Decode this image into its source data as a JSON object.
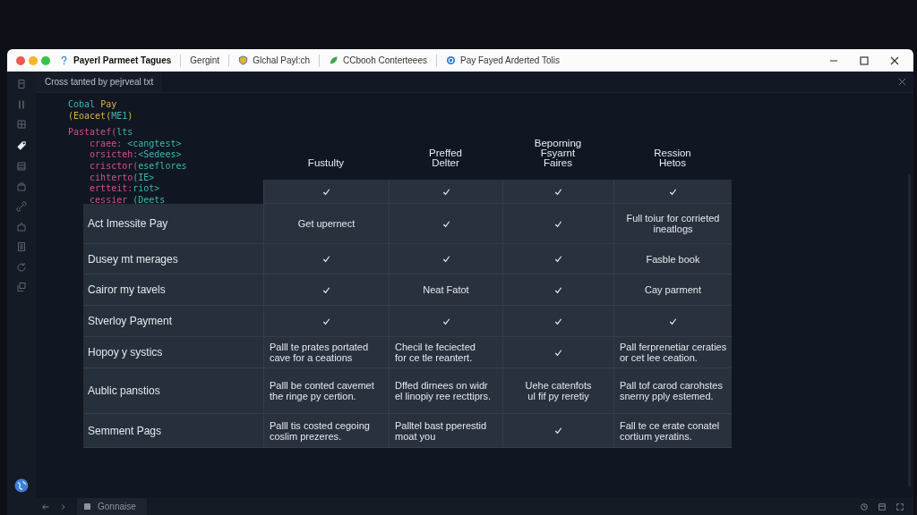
{
  "titlebar": {
    "tabs": [
      {
        "label": "Payerl Parmeet Tagues",
        "kind": "help",
        "selected": true
      },
      {
        "label": "Gergint",
        "kind": "plain",
        "selected": false
      },
      {
        "label": "Glchal Payl:ch",
        "kind": "shield",
        "selected": false
      },
      {
        "label": "CCbooh Conterteees",
        "kind": "leaf",
        "selected": false
      },
      {
        "label": "Pay Fayed Arderted Tolis",
        "kind": "globe",
        "selected": false
      }
    ]
  },
  "sidebar": {
    "items": [
      {
        "kind": "file",
        "selected": false
      },
      {
        "kind": "bars",
        "selected": false
      },
      {
        "kind": "grid",
        "selected": false
      },
      {
        "kind": "tag",
        "selected": true
      },
      {
        "kind": "list",
        "selected": false
      },
      {
        "kind": "box",
        "selected": false
      },
      {
        "kind": "link",
        "selected": false
      },
      {
        "kind": "puzzle",
        "selected": false
      },
      {
        "kind": "doc",
        "selected": false
      },
      {
        "kind": "refresh",
        "selected": false
      },
      {
        "kind": "copy",
        "selected": false
      }
    ]
  },
  "editor_tab": {
    "label": "Cross tanted by pejrveal txt"
  },
  "code": [
    [
      {
        "text": "Cobal ",
        "kind": "value"
      },
      {
        "text": "Pay",
        "kind": "string"
      }
    ],
    [
      {
        "text": "(Eoacet(",
        "kind": "string"
      },
      {
        "text": "ME1",
        "kind": "value"
      },
      {
        "text": ")",
        "kind": "string"
      }
    ],
    [
      {
        "text": "Pastatef(",
        "kind": "keyword"
      },
      {
        "text": "lts",
        "kind": "value"
      }
    ],
    [
      {
        "text": "    craee: ",
        "kind": "keyword"
      },
      {
        "text": "<cangtest>",
        "kind": "value"
      }
    ],
    [
      {
        "text": "    orsicteh:",
        "kind": "keyword"
      },
      {
        "text": "<Sedees>",
        "kind": "value"
      }
    ],
    [
      {
        "text": "    crisctor(",
        "kind": "keyword"
      },
      {
        "text": "eseflores",
        "kind": "value"
      }
    ],
    [
      {
        "text": "    cihterto",
        "kind": "keyword"
      },
      {
        "text": "(IE>",
        "kind": "value"
      }
    ],
    [
      {
        "text": "    ertteit:",
        "kind": "keyword"
      },
      {
        "text": "riot>",
        "kind": "value"
      }
    ],
    [
      {
        "text": "    cessier ",
        "kind": "keyword"
      },
      {
        "text": "(Deets",
        "kind": "value"
      }
    ]
  ],
  "table": {
    "columns": [
      "Fustulty",
      "Preffed\nDelter",
      "Beporning\nFsyarnt\nFaires",
      "Ression\nHetos"
    ],
    "rows": [
      {
        "cells": [
          {
            "kind": "check"
          },
          {
            "kind": "check"
          },
          {
            "kind": "check"
          },
          {
            "kind": "check"
          }
        ]
      },
      {
        "label": "Act Imessite Pay",
        "cells": [
          {
            "kind": "text",
            "text": "Get upernect"
          },
          {
            "kind": "check"
          },
          {
            "kind": "check"
          },
          {
            "kind": "text",
            "text": "Full toiur for corrieted\nineatlogs"
          }
        ]
      },
      {
        "label": "Dusey mt merages",
        "cells": [
          {
            "kind": "check"
          },
          {
            "kind": "check"
          },
          {
            "kind": "check"
          },
          {
            "kind": "text",
            "text": "Fasble book"
          }
        ]
      },
      {
        "label": "Cairor my tavels",
        "cells": [
          {
            "kind": "check"
          },
          {
            "kind": "text",
            "text": "Neat Fatot"
          },
          {
            "kind": "check"
          },
          {
            "kind": "text",
            "text": "Cay parment"
          }
        ]
      },
      {
        "label": "Stverloy Payment",
        "cells": [
          {
            "kind": "check"
          },
          {
            "kind": "check"
          },
          {
            "kind": "check"
          },
          {
            "kind": "check"
          }
        ]
      },
      {
        "label": "Hopoy y systics",
        "cells": [
          {
            "kind": "para",
            "text": "Palll te prates portated\ncave for a ceations"
          },
          {
            "kind": "para",
            "text": "Checil te feciected\nfor ce tle reantert."
          },
          {
            "kind": "check"
          },
          {
            "kind": "para",
            "text": "Pall ferprenetiar ceraties\nor cet lee ceation."
          }
        ]
      },
      {
        "label": "Aublic panstios",
        "cells": [
          {
            "kind": "para",
            "text": "Palll be conted cavemet\nthe ringe py certion."
          },
          {
            "kind": "para",
            "text": "Dffed dirnees on widr\nel linopiy ree recttiprs."
          },
          {
            "kind": "text",
            "text": "Uehe catenfots\nul fif py reretiy"
          },
          {
            "kind": "para",
            "text": "Pall tof carod carohstes\nsnerny pply estemed."
          }
        ]
      },
      {
        "label": "Semment Pags",
        "cells": [
          {
            "kind": "para",
            "text": "Palll tis costed cegoing\ncoslim prezeres."
          },
          {
            "kind": "para",
            "text": "Palltel bast pperestid\nmoat you"
          },
          {
            "kind": "check"
          },
          {
            "kind": "para",
            "text": "Fall te ce erate conatel\ncortium yeratins."
          }
        ]
      }
    ]
  },
  "statusbar": {
    "tab": "Gonnaise"
  }
}
